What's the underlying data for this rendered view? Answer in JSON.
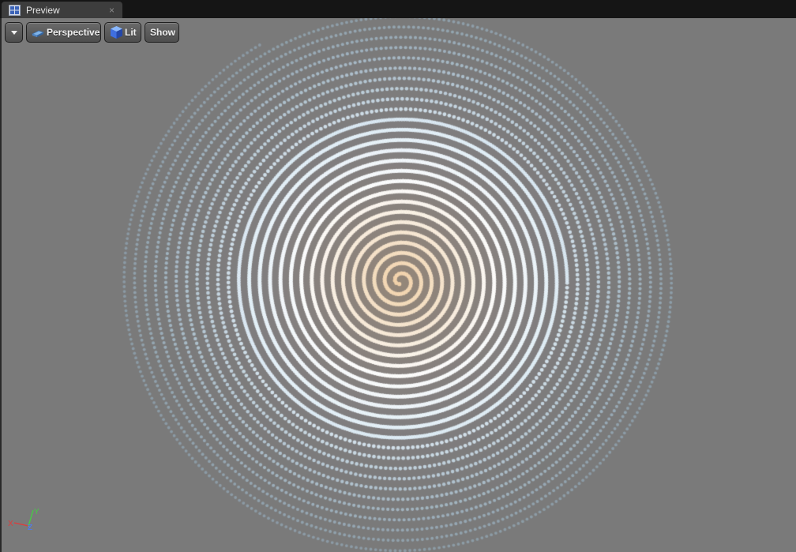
{
  "tab": {
    "title": "Preview",
    "icon": "viewport-grid-icon",
    "close_glyph": "×"
  },
  "toolbar": {
    "menu_icon": "chevron-down-icon",
    "perspective_label": "Perspective",
    "perspective_icon": "perspective-camera-icon",
    "lit_label": "Lit",
    "lit_icon": "lit-cube-icon",
    "show_label": "Show"
  },
  "axes": {
    "x_label": "X",
    "y_label": "Y",
    "z_label": "Z",
    "x_color": "#e03a3a",
    "y_color": "#48c848",
    "z_color": "#4a7aff"
  },
  "scene": {
    "background": "#7a7a7a",
    "center_color": "#f3d2a8",
    "mid_color": "#ffffff",
    "outer_color": "#a8d2ee",
    "shape": "spiral particle field"
  }
}
